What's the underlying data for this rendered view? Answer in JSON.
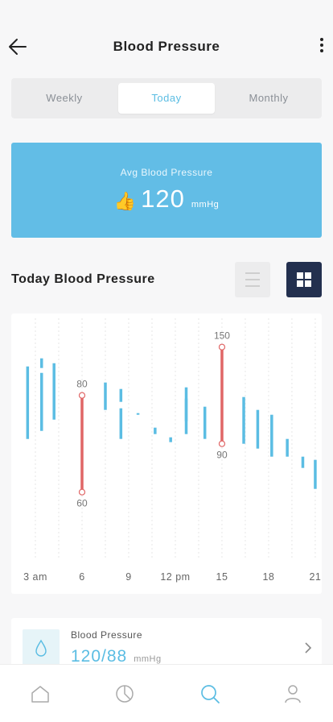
{
  "header": {
    "title": "Blood Pressure"
  },
  "segments": {
    "weekly": "Weekly",
    "today": "Today",
    "monthly": "Monthly"
  },
  "avg": {
    "label": "Avg Blood Pressure",
    "icon": "thumbs-up-icon",
    "value": "120",
    "unit": "mmHg"
  },
  "section": {
    "title": "Today Blood Pressure"
  },
  "chart_data": {
    "type": "range-bar",
    "x_tick_labels": [
      "3 am",
      "6",
      "9",
      "12 pm",
      "15",
      "18",
      "21"
    ],
    "bars": [
      {
        "x": 2.5,
        "high": 138,
        "low": 93
      },
      {
        "x": 3.4,
        "high": 143,
        "low": 137
      },
      {
        "x": 3.4,
        "high": 134,
        "low": 98
      },
      {
        "x": 4.2,
        "high": 140,
        "low": 105
      },
      {
        "x": 6.0,
        "high": 120,
        "low": 60,
        "highlight": true,
        "high_label": "80",
        "low_label": "60"
      },
      {
        "x": 7.5,
        "high": 128,
        "low": 111
      },
      {
        "x": 8.5,
        "high": 124,
        "low": 116
      },
      {
        "x": 8.5,
        "high": 112,
        "low": 93
      },
      {
        "x": 9.6,
        "high": 109,
        "low": 108
      },
      {
        "x": 10.7,
        "high": 100,
        "low": 96
      },
      {
        "x": 11.7,
        "high": 94,
        "low": 91
      },
      {
        "x": 12.7,
        "high": 125,
        "low": 104
      },
      {
        "x": 12.7,
        "high": 118,
        "low": 96
      },
      {
        "x": 13.9,
        "high": 113,
        "low": 93
      },
      {
        "x": 15.0,
        "high": 150,
        "low": 90,
        "highlight": true,
        "high_label": "150",
        "low_label": "90"
      },
      {
        "x": 16.4,
        "high": 119,
        "low": 90
      },
      {
        "x": 17.3,
        "high": 111,
        "low": 87
      },
      {
        "x": 18.2,
        "high": 108,
        "low": 82
      },
      {
        "x": 19.2,
        "high": 93,
        "low": 82
      },
      {
        "x": 20.2,
        "high": 82,
        "low": 75
      },
      {
        "x": 21.0,
        "high": 80,
        "low": 62
      }
    ],
    "colors": {
      "bar": "#5bbde3",
      "highlight": "#e06666",
      "grid": "#e6e6e6",
      "label": "#777777"
    }
  },
  "card": {
    "label": "Blood Pressure",
    "value": "120/88",
    "unit": "mmHg",
    "icon": "drop-icon"
  },
  "tabbar": {
    "items": [
      "home-icon",
      "pie-chart-icon",
      "search-icon",
      "profile-icon"
    ],
    "active": "search-icon"
  },
  "colors": {
    "accent": "#5bbde3",
    "banner": "#62bde6",
    "dark_button": "#23304f",
    "highlight": "#e06666"
  }
}
